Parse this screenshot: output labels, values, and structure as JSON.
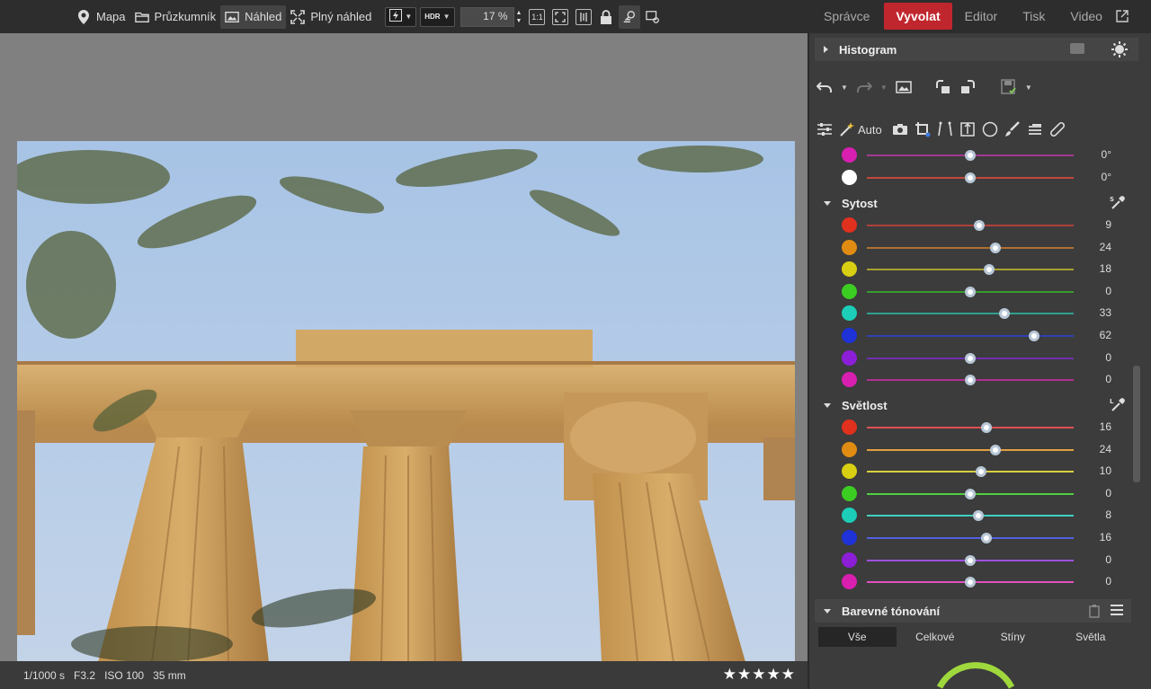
{
  "toolbar": {
    "items": [
      {
        "label": "Mapa",
        "icon": "map-pin-icon"
      },
      {
        "label": "Průzkumník",
        "icon": "folder-icon"
      },
      {
        "label": "Náhled",
        "icon": "image-icon",
        "active": true
      },
      {
        "label": "Plný náhled",
        "icon": "fullscreen-icon"
      }
    ],
    "hdr_label": "HDR",
    "zoom_value": "17 %",
    "one_to_one_label": "1:1"
  },
  "modes": [
    {
      "label": "Správce"
    },
    {
      "label": "Vyvolat",
      "active": true
    },
    {
      "label": "Editor"
    },
    {
      "label": "Tisk"
    },
    {
      "label": "Video"
    }
  ],
  "status": {
    "shutter": "1/1000 s",
    "aperture": "F3.2",
    "iso": "ISO 100",
    "focal": "35 mm",
    "rating_stars": 5
  },
  "panel": {
    "histogram_title": "Histogram",
    "auto_label": "Auto",
    "hue_rows": [
      {
        "color": "#d81fb0",
        "value": "0°",
        "pos": 50,
        "track": "#a13a8f"
      },
      {
        "color": "#ffffff",
        "value": "0°",
        "pos": 50,
        "track": "#c04a3a"
      }
    ],
    "saturation": {
      "title": "Sytost",
      "rows": [
        {
          "color": "#e0301e",
          "value": "9",
          "pos": 54.5,
          "track": "#b0403a"
        },
        {
          "color": "#e08c12",
          "value": "24",
          "pos": 62,
          "track": "#b07030"
        },
        {
          "color": "#d8cf12",
          "value": "18",
          "pos": 59,
          "track": "#a8a030"
        },
        {
          "color": "#3ccd22",
          "value": "0",
          "pos": 50,
          "track": "#3a9a30"
        },
        {
          "color": "#1ccdb8",
          "value": "33",
          "pos": 66.5,
          "track": "#30a090"
        },
        {
          "color": "#1e32d8",
          "value": "62",
          "pos": 81,
          "track": "#3040b0"
        },
        {
          "color": "#8c1ed8",
          "value": "0",
          "pos": 50,
          "track": "#7030b0"
        },
        {
          "color": "#d81fb0",
          "value": "0",
          "pos": 50,
          "track": "#b03090"
        }
      ]
    },
    "lightness": {
      "title": "Světlost",
      "rows": [
        {
          "color": "#e0301e",
          "value": "16",
          "pos": 58,
          "track": "#e05050"
        },
        {
          "color": "#e08c12",
          "value": "24",
          "pos": 62,
          "track": "#e0a040"
        },
        {
          "color": "#d8cf12",
          "value": "10",
          "pos": 55,
          "track": "#d8d040"
        },
        {
          "color": "#3ccd22",
          "value": "0",
          "pos": 50,
          "track": "#50d040"
        },
        {
          "color": "#1ccdb8",
          "value": "8",
          "pos": 54,
          "track": "#40d0c0"
        },
        {
          "color": "#1e32d8",
          "value": "16",
          "pos": 58,
          "track": "#5060e0"
        },
        {
          "color": "#8c1ed8",
          "value": "0",
          "pos": 50,
          "track": "#a050e0"
        },
        {
          "color": "#d81fb0",
          "value": "0",
          "pos": 50,
          "track": "#e050c0"
        }
      ]
    },
    "toning": {
      "title": "Barevné tónování",
      "tabs": [
        {
          "label": "Vše",
          "active": true
        },
        {
          "label": "Celkové"
        },
        {
          "label": "Stíny"
        },
        {
          "label": "Světla"
        }
      ]
    }
  }
}
